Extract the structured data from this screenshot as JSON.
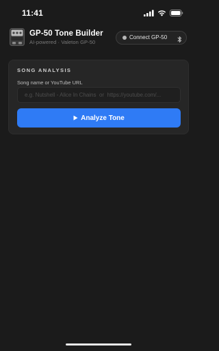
{
  "status_bar": {
    "time": "11:41",
    "icons": [
      "cellular-signal-icon",
      "wifi-icon",
      "battery-icon"
    ]
  },
  "header": {
    "logo_icon": "pedal-device-icon",
    "title": "GP-50 Tone Builder",
    "subtitle": "AI-powered · Valeton GP-50",
    "connect_button": {
      "label": "Connect GP-50",
      "status_dot_color": "#b7b7b7",
      "icon": "bluetooth-icon"
    }
  },
  "analysis_card": {
    "section_title": "SONG ANALYSIS",
    "input": {
      "label": "Song name or YouTube URL",
      "value": "",
      "placeholder": "e.g. Nutshell - Alice In Chains  or  https://youtube.com/..."
    },
    "analyze_button": {
      "label": "Analyze Tone",
      "icon": "play-icon",
      "color": "#2f7bf5"
    }
  },
  "colors": {
    "background": "#1b1b1b",
    "card": "#262626",
    "accent": "#2f7bf5"
  }
}
